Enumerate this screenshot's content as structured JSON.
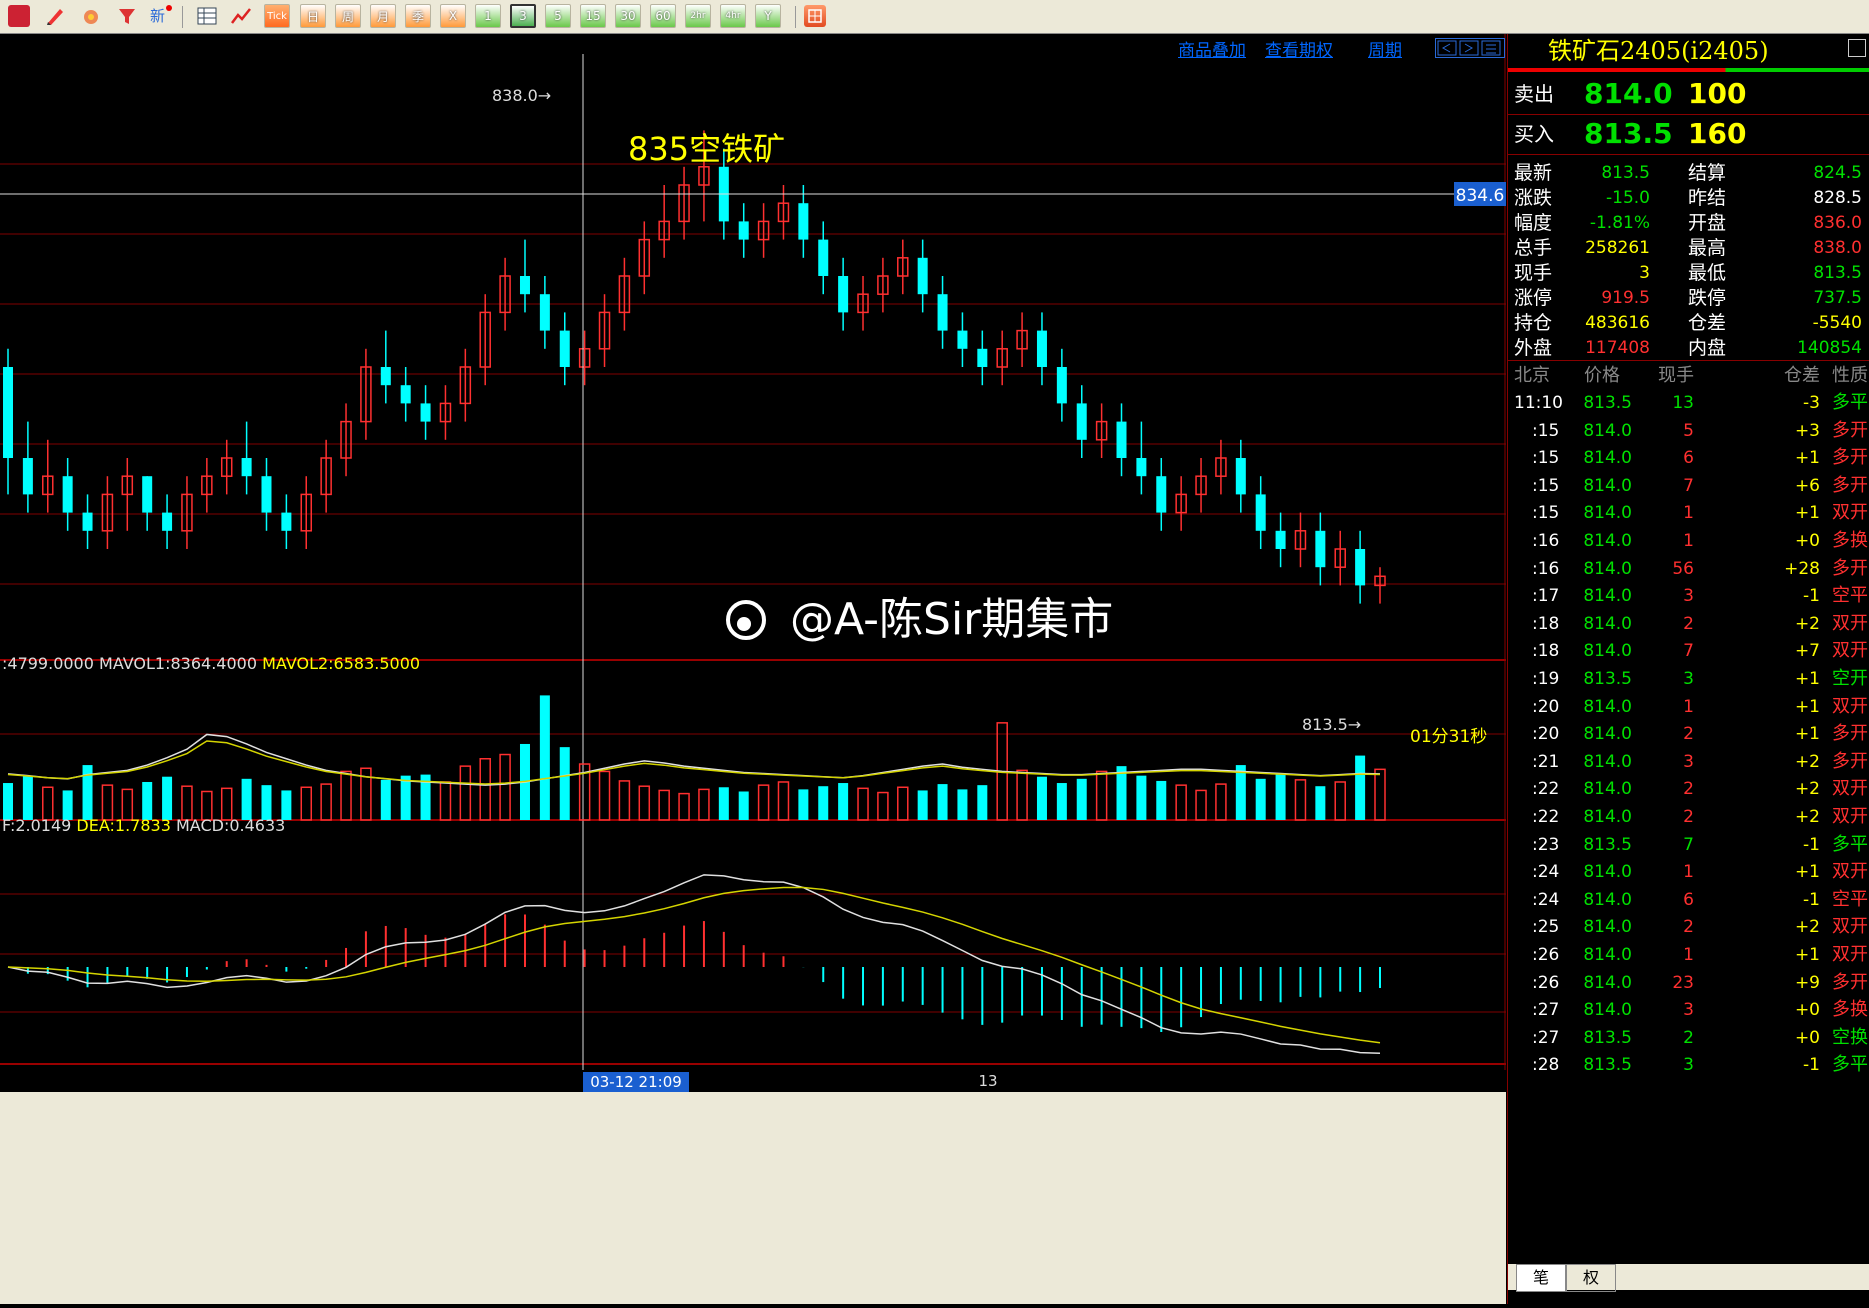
{
  "toolbar": {
    "icons": [
      "monitor-icon",
      "pencil-icon",
      "paint-icon",
      "filter-icon",
      "new-icon",
      "table-icon",
      "chart-icon"
    ],
    "new_label": "新",
    "tick_label": "Tick",
    "periods": [
      "日",
      "周",
      "月",
      "季",
      "X",
      "1",
      "3",
      "5",
      "15",
      "30",
      "60",
      "2hr",
      "4hr",
      "Y"
    ],
    "active_period": "3",
    "last_icon": "grid-icon"
  },
  "chart_links": {
    "overlay": "商品叠加",
    "options": "查看期权",
    "cycle": "周期"
  },
  "price_chart": {
    "annotation": "835空铁矿",
    "high_marker": "838.0→",
    "low_marker": "813.5→",
    "crosshair_price": "834.6",
    "countdown": "01分31秒",
    "watermark": "@A-陈Sir期集市"
  },
  "volume_panel": {
    "label_vol": ":4799.0000",
    "label_mavol1": "MAVOL1:8364.4000",
    "label_mavol2": "MAVOL2:6583.5000"
  },
  "macd_panel": {
    "label_dif": "F:2.0149",
    "label_dea": "DEA:1.7833",
    "label_macd": "MACD:0.4633"
  },
  "time_axis": {
    "cursor_time": "03-12 21:09",
    "day_label": "13"
  },
  "chart_data": {
    "type": "candlestick",
    "interval": "3",
    "ohlc": [
      [
        825,
        826,
        818,
        820
      ],
      [
        820,
        822,
        817,
        818
      ],
      [
        818,
        821,
        817,
        819
      ],
      [
        819,
        820,
        816,
        817
      ],
      [
        817,
        818,
        815,
        816
      ],
      [
        816,
        819,
        815,
        818
      ],
      [
        818,
        820,
        816,
        819
      ],
      [
        819,
        819,
        816,
        817
      ],
      [
        817,
        818,
        815,
        816
      ],
      [
        816,
        819,
        815,
        818
      ],
      [
        818,
        820,
        817,
        819
      ],
      [
        819,
        821,
        818,
        820
      ],
      [
        820,
        822,
        818,
        819
      ],
      [
        819,
        820,
        816,
        817
      ],
      [
        817,
        818,
        815,
        816
      ],
      [
        816,
        819,
        815,
        818
      ],
      [
        818,
        821,
        817,
        820
      ],
      [
        820,
        823,
        819,
        822
      ],
      [
        822,
        826,
        821,
        825
      ],
      [
        825,
        827,
        823,
        824
      ],
      [
        824,
        825,
        822,
        823
      ],
      [
        823,
        824,
        821,
        822
      ],
      [
        822,
        824,
        821,
        823
      ],
      [
        823,
        826,
        822,
        825
      ],
      [
        825,
        829,
        824,
        828
      ],
      [
        828,
        831,
        827,
        830
      ],
      [
        830,
        832,
        828,
        829
      ],
      [
        829,
        830,
        826,
        827
      ],
      [
        827,
        828,
        824,
        825
      ],
      [
        825,
        827,
        824,
        826
      ],
      [
        826,
        829,
        825,
        828
      ],
      [
        828,
        831,
        827,
        830
      ],
      [
        830,
        833,
        829,
        832
      ],
      [
        832,
        835,
        831,
        833
      ],
      [
        833,
        836,
        832,
        835
      ],
      [
        835,
        838,
        833,
        836
      ],
      [
        836,
        837,
        832,
        833
      ],
      [
        833,
        834,
        831,
        832
      ],
      [
        832,
        834,
        831,
        833
      ],
      [
        833,
        835,
        832,
        834
      ],
      [
        834,
        835,
        831,
        832
      ],
      [
        832,
        833,
        829,
        830
      ],
      [
        830,
        831,
        827,
        828
      ],
      [
        828,
        830,
        827,
        829
      ],
      [
        829,
        831,
        828,
        830
      ],
      [
        830,
        832,
        829,
        831
      ],
      [
        831,
        832,
        828,
        829
      ],
      [
        829,
        830,
        826,
        827
      ],
      [
        827,
        828,
        825,
        826
      ],
      [
        826,
        827,
        824,
        825
      ],
      [
        825,
        827,
        824,
        826
      ],
      [
        826,
        828,
        825,
        827
      ],
      [
        827,
        828,
        824,
        825
      ],
      [
        825,
        826,
        822,
        823
      ],
      [
        823,
        824,
        820,
        821
      ],
      [
        821,
        823,
        820,
        822
      ],
      [
        822,
        823,
        819,
        820
      ],
      [
        820,
        822,
        818,
        819
      ],
      [
        819,
        820,
        816,
        817
      ],
      [
        817,
        819,
        816,
        818
      ],
      [
        818,
        820,
        817,
        819
      ],
      [
        819,
        821,
        818,
        820
      ],
      [
        820,
        821,
        817,
        818
      ],
      [
        818,
        819,
        815,
        816
      ],
      [
        816,
        817,
        814,
        815
      ],
      [
        815,
        817,
        814,
        816
      ],
      [
        816,
        817,
        813,
        814
      ],
      [
        814,
        816,
        813,
        815
      ],
      [
        815,
        816,
        812,
        813
      ],
      [
        813,
        814,
        812,
        813.5
      ]
    ],
    "volume": [
      3500,
      4200,
      3100,
      2800,
      5200,
      3300,
      2900,
      3600,
      4100,
      3200,
      2700,
      3000,
      3900,
      3300,
      2800,
      3100,
      3400,
      4600,
      4900,
      3800,
      4200,
      4300,
      3600,
      5100,
      5800,
      6200,
      7200,
      11800,
      6900,
      5300,
      4600,
      3700,
      3200,
      2800,
      2500,
      2900,
      3100,
      2700,
      3300,
      3600,
      2900,
      3200,
      3500,
      3000,
      2600,
      3100,
      2800,
      3400,
      2900,
      3300,
      9200,
      4700,
      4100,
      3500,
      3900,
      4600,
      5100,
      4200,
      3700,
      3300,
      2800,
      3400,
      5200,
      3900,
      4400,
      3800,
      3200,
      3600,
      6100,
      4799
    ],
    "mavol1": [
      4364,
      4200,
      4000,
      3900,
      4300,
      4500,
      4700,
      5200,
      5900,
      6700,
      8100,
      7900,
      7200,
      6400,
      5800,
      5200,
      4700,
      4400,
      4100,
      3900,
      3700,
      3600,
      3500,
      3400,
      3300,
      3400,
      3600,
      3900,
      4200,
      4500,
      4900,
      5300,
      5600,
      5400,
      5100,
      4900,
      4700,
      4500,
      4400,
      4300,
      4200,
      4100,
      4000,
      4200,
      4500,
      4800,
      5100,
      5300,
      5000,
      4800,
      4600,
      4500,
      4400,
      4300,
      4300,
      4400,
      4500,
      4600,
      4700,
      4800,
      4800,
      4700,
      4600,
      4500,
      4400,
      4300,
      4200,
      4300,
      4400,
      4364
    ],
    "macd": {
      "dif": 2.0149,
      "dea": 1.7833,
      "macd": 0.4633
    }
  },
  "quote": {
    "title": "铁矿石2405(i2405)",
    "ask_label": "卖出",
    "ask_price": "814.0",
    "ask_vol": "100",
    "bid_label": "买入",
    "bid_price": "813.5",
    "bid_vol": "160",
    "stats": [
      {
        "l1": "最新",
        "v1": "813.5",
        "c1": "#00e000",
        "l2": "结算",
        "v2": "824.5",
        "c2": "#00e000"
      },
      {
        "l1": "涨跌",
        "v1": "-15.0",
        "c1": "#00e000",
        "l2": "昨结",
        "v2": "828.5",
        "c2": "#ffffff"
      },
      {
        "l1": "幅度",
        "v1": "-1.81%",
        "c1": "#00e000",
        "l2": "开盘",
        "v2": "836.0",
        "c2": "#ff3030"
      },
      {
        "l1": "总手",
        "v1": "258261",
        "c1": "#ffff00",
        "l2": "最高",
        "v2": "838.0",
        "c2": "#ff3030"
      },
      {
        "l1": "现手",
        "v1": "3",
        "c1": "#ffff00",
        "l2": "最低",
        "v2": "813.5",
        "c2": "#00e000"
      },
      {
        "l1": "涨停",
        "v1": "919.5",
        "c1": "#ff3030",
        "l2": "跌停",
        "v2": "737.5",
        "c2": "#00e000"
      },
      {
        "l1": "持仓",
        "v1": "483616",
        "c1": "#ffff00",
        "l2": "仓差",
        "v2": "-5540",
        "c2": "#ffff00"
      },
      {
        "l1": "外盘",
        "v1": "117408",
        "c1": "#ff3030",
        "l2": "内盘",
        "v2": "140854",
        "c2": "#00e000"
      }
    ],
    "tick_headers": [
      "北京",
      "价格",
      "现手",
      "仓差",
      "性质"
    ],
    "ticks": [
      {
        "t": "11:10",
        "p": "813.5",
        "pc": "#00e000",
        "v": "13",
        "vc": "#00e000",
        "d": "-3",
        "dc": "#ffff00",
        "n": "多平",
        "nc": "#00e000"
      },
      {
        "t": ":15",
        "p": "814.0",
        "pc": "#00e000",
        "v": "5",
        "vc": "#ff3030",
        "d": "+3",
        "dc": "#ffff00",
        "n": "多开",
        "nc": "#ff3030"
      },
      {
        "t": ":15",
        "p": "814.0",
        "pc": "#00e000",
        "v": "6",
        "vc": "#ff3030",
        "d": "+1",
        "dc": "#ffff00",
        "n": "多开",
        "nc": "#ff3030"
      },
      {
        "t": ":15",
        "p": "814.0",
        "pc": "#00e000",
        "v": "7",
        "vc": "#ff3030",
        "d": "+6",
        "dc": "#ffff00",
        "n": "多开",
        "nc": "#ff3030"
      },
      {
        "t": ":15",
        "p": "814.0",
        "pc": "#00e000",
        "v": "1",
        "vc": "#ff3030",
        "d": "+1",
        "dc": "#ffff00",
        "n": "双开",
        "nc": "#ff3030"
      },
      {
        "t": ":16",
        "p": "814.0",
        "pc": "#00e000",
        "v": "1",
        "vc": "#ff3030",
        "d": "+0",
        "dc": "#ffff00",
        "n": "多换",
        "nc": "#ff3030"
      },
      {
        "t": ":16",
        "p": "814.0",
        "pc": "#00e000",
        "v": "56",
        "vc": "#ff3030",
        "d": "+28",
        "dc": "#ffff00",
        "n": "多开",
        "nc": "#ff3030"
      },
      {
        "t": ":17",
        "p": "814.0",
        "pc": "#00e000",
        "v": "3",
        "vc": "#ff3030",
        "d": "-1",
        "dc": "#ffff00",
        "n": "空平",
        "nc": "#ff3030"
      },
      {
        "t": ":18",
        "p": "814.0",
        "pc": "#00e000",
        "v": "2",
        "vc": "#ff3030",
        "d": "+2",
        "dc": "#ffff00",
        "n": "双开",
        "nc": "#ff3030"
      },
      {
        "t": ":18",
        "p": "814.0",
        "pc": "#00e000",
        "v": "7",
        "vc": "#ff3030",
        "d": "+7",
        "dc": "#ffff00",
        "n": "双开",
        "nc": "#ff3030"
      },
      {
        "t": ":19",
        "p": "813.5",
        "pc": "#00e000",
        "v": "3",
        "vc": "#00e000",
        "d": "+1",
        "dc": "#ffff00",
        "n": "空开",
        "nc": "#00e000"
      },
      {
        "t": ":20",
        "p": "814.0",
        "pc": "#00e000",
        "v": "1",
        "vc": "#ff3030",
        "d": "+1",
        "dc": "#ffff00",
        "n": "双开",
        "nc": "#ff3030"
      },
      {
        "t": ":20",
        "p": "814.0",
        "pc": "#00e000",
        "v": "2",
        "vc": "#ff3030",
        "d": "+1",
        "dc": "#ffff00",
        "n": "多开",
        "nc": "#ff3030"
      },
      {
        "t": ":21",
        "p": "814.0",
        "pc": "#00e000",
        "v": "3",
        "vc": "#ff3030",
        "d": "+2",
        "dc": "#ffff00",
        "n": "多开",
        "nc": "#ff3030"
      },
      {
        "t": ":22",
        "p": "814.0",
        "pc": "#00e000",
        "v": "2",
        "vc": "#ff3030",
        "d": "+2",
        "dc": "#ffff00",
        "n": "双开",
        "nc": "#ff3030"
      },
      {
        "t": ":22",
        "p": "814.0",
        "pc": "#00e000",
        "v": "2",
        "vc": "#ff3030",
        "d": "+2",
        "dc": "#ffff00",
        "n": "双开",
        "nc": "#ff3030"
      },
      {
        "t": ":23",
        "p": "813.5",
        "pc": "#00e000",
        "v": "7",
        "vc": "#00e000",
        "d": "-1",
        "dc": "#ffff00",
        "n": "多平",
        "nc": "#00e000"
      },
      {
        "t": ":24",
        "p": "814.0",
        "pc": "#00e000",
        "v": "1",
        "vc": "#ff3030",
        "d": "+1",
        "dc": "#ffff00",
        "n": "双开",
        "nc": "#ff3030"
      },
      {
        "t": ":24",
        "p": "814.0",
        "pc": "#00e000",
        "v": "6",
        "vc": "#ff3030",
        "d": "-1",
        "dc": "#ffff00",
        "n": "空平",
        "nc": "#ff3030"
      },
      {
        "t": ":25",
        "p": "814.0",
        "pc": "#00e000",
        "v": "2",
        "vc": "#ff3030",
        "d": "+2",
        "dc": "#ffff00",
        "n": "双开",
        "nc": "#ff3030"
      },
      {
        "t": ":26",
        "p": "814.0",
        "pc": "#00e000",
        "v": "1",
        "vc": "#ff3030",
        "d": "+1",
        "dc": "#ffff00",
        "n": "双开",
        "nc": "#ff3030"
      },
      {
        "t": ":26",
        "p": "814.0",
        "pc": "#00e000",
        "v": "23",
        "vc": "#ff3030",
        "d": "+9",
        "dc": "#ffff00",
        "n": "多开",
        "nc": "#ff3030"
      },
      {
        "t": ":27",
        "p": "814.0",
        "pc": "#00e000",
        "v": "3",
        "vc": "#ff3030",
        "d": "+0",
        "dc": "#ffff00",
        "n": "多换",
        "nc": "#ff3030"
      },
      {
        "t": ":27",
        "p": "813.5",
        "pc": "#00e000",
        "v": "2",
        "vc": "#00e000",
        "d": "+0",
        "dc": "#ffff00",
        "n": "空换",
        "nc": "#00e000"
      },
      {
        "t": ":28",
        "p": "813.5",
        "pc": "#00e000",
        "v": "3",
        "vc": "#00e000",
        "d": "-1",
        "dc": "#ffff00",
        "n": "多平",
        "nc": "#00e000"
      }
    ],
    "bottom_tabs": [
      "笔",
      "权"
    ]
  },
  "colors": {
    "up": "#ff3030",
    "down": "#00ffff",
    "grid": "#800000",
    "ma_white": "#e0e0e0",
    "ma_yellow": "#d4d400"
  }
}
